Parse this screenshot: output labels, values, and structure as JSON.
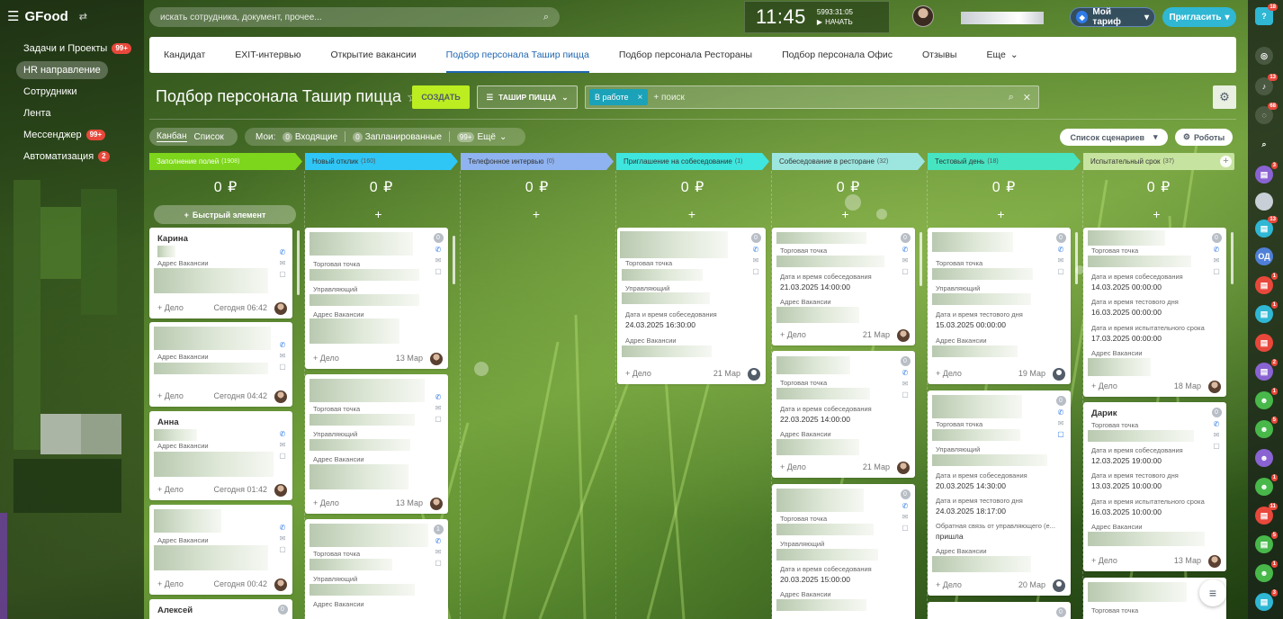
{
  "app": {
    "brand": "GFood",
    "search_placeholder": "искать сотрудника, документ, прочее...",
    "clock_time": "11:45",
    "clock_counter": "5993:31:05",
    "clock_start": "НАЧАТЬ",
    "tariff_label": "Мой тариф",
    "invite_label": "Пригласить"
  },
  "sidebar": {
    "items": [
      {
        "label": "Задачи и Проекты",
        "badge": "99+"
      },
      {
        "label": "HR направление",
        "badge": ""
      },
      {
        "label": "Сотрудники",
        "badge": ""
      },
      {
        "label": "Лента",
        "badge": ""
      },
      {
        "label": "Мессенджер",
        "badge": "99+"
      },
      {
        "label": "Автоматизация",
        "badge": "2"
      }
    ]
  },
  "tabs": [
    "Кандидат",
    "EXIT-интервью",
    "Открытие вакансии",
    "Подбор персонала Ташир пицца",
    "Подбор персонала Рестораны",
    "Подбор персонала Офис",
    "Отзывы",
    "Еще"
  ],
  "page": {
    "title": "Подбор персонала Ташир пицца",
    "create_label": "СОЗДАТЬ",
    "pipeline_label": "ТАШИР ПИЦЦА",
    "filter_chip": "В работе",
    "filter_placeholder": "+ поиск"
  },
  "toolbar": {
    "kanban": "Канбан",
    "list": "Список",
    "mine": "Мои:",
    "incoming_count": "0",
    "incoming": "Входящие",
    "planned_count": "0",
    "planned": "Запланированные",
    "more_count": "99+",
    "more": "Ещё",
    "scenarios": "Список сценариев",
    "robots": "Роботы"
  },
  "kanban": {
    "quick_add": "Быстрый элемент",
    "columns": [
      {
        "title": "Заполнение полей",
        "count": "(1908)",
        "sum": "0 ₽",
        "color": "#7dd61b"
      },
      {
        "title": "Новый отклик",
        "count": "(160)",
        "sum": "0 ₽",
        "color": "#2fc6f6"
      },
      {
        "title": "Телефонное интервью",
        "count": "(0)",
        "sum": "0 ₽",
        "color": "#8fb3f0"
      },
      {
        "title": "Приглашение на собеседование",
        "count": "(1)",
        "sum": "0 ₽",
        "color": "#3fe6de"
      },
      {
        "title": "Собеседование в ресторане",
        "count": "(32)",
        "sum": "0 ₽",
        "color": "#9de6e0"
      },
      {
        "title": "Тестовый день",
        "count": "(18)",
        "sum": "0 ₽",
        "color": "#47e4c2"
      },
      {
        "title": "Испытательный срок",
        "count": "(37)",
        "sum": "0 ₽",
        "color": "#c7e3a0"
      }
    ],
    "labels": {
      "address": "Адрес Вакансии",
      "point": "Торговая точка",
      "manager": "Управляющий",
      "interview_dt": "Дата и время собеседования",
      "test_dt": "Дата и время тестового дня",
      "probation_dt": "Дата и время испытательного срока",
      "feedback": "Обратная связь от управляющего (е...",
      "deal": "+ Дело"
    },
    "cards": {
      "c1_1": {
        "name": "Карина",
        "date": "Сегодня 06:42"
      },
      "c1_2": {
        "date": "Сегодня 04:42"
      },
      "c1_3": {
        "name": "Анна",
        "date": "Сегодня 01:42"
      },
      "c1_4": {
        "date": "Сегодня 00:42"
      },
      "c1_5": {
        "name": "Алексей"
      },
      "c2_1": {
        "count": "0",
        "date": "13 Мар"
      },
      "c2_2": {
        "count": "0",
        "date": "13 Мар"
      },
      "c2_3": {
        "count": "1"
      },
      "c4_1": {
        "count": "0",
        "interview": "24.03.2025 16:30:00",
        "date": "21 Мар"
      },
      "c5_1": {
        "count": "0",
        "interview": "21.03.2025 14:00:00",
        "date": "21 Мар"
      },
      "c5_2": {
        "count": "0",
        "interview": "22.03.2025 14:00:00",
        "date": "21 Мар"
      },
      "c5_3": {
        "count": "0",
        "interview": "20.03.2025 15:00:00"
      },
      "c6_1": {
        "count": "0",
        "test": "15.03.2025 00:00:00",
        "date": "19 Мар"
      },
      "c6_2": {
        "count": "0",
        "interview": "20.03.2025 14:30:00",
        "test": "24.03.2025 18:17:00",
        "feedback": "пришла",
        "date": "20 Мар"
      },
      "c7_1": {
        "count": "0",
        "interview": "14.03.2025 00:00:00",
        "test": "16.03.2025 00:00:00",
        "probation": "17.03.2025 00:00:00",
        "date": "18 Мар"
      },
      "c7_2": {
        "name": "Дарик",
        "count": "0",
        "interview": "12.03.2025 19:00:00",
        "test": "13.03.2025 10:00:00",
        "probation": "16.03.2025 10:00:00",
        "date": "13 Мар"
      }
    }
  },
  "rail": {
    "badges": [
      "18",
      "13",
      "68",
      "3",
      "13",
      "1",
      "1",
      "2",
      "1",
      "5",
      "1",
      "11",
      "5",
      "1",
      "3"
    ],
    "od_label": "ОД"
  },
  "colors": {
    "create": "#bbed21",
    "accent": "#2067b0",
    "invite": "#2fb7d4",
    "chip": "#1ba2b8"
  }
}
